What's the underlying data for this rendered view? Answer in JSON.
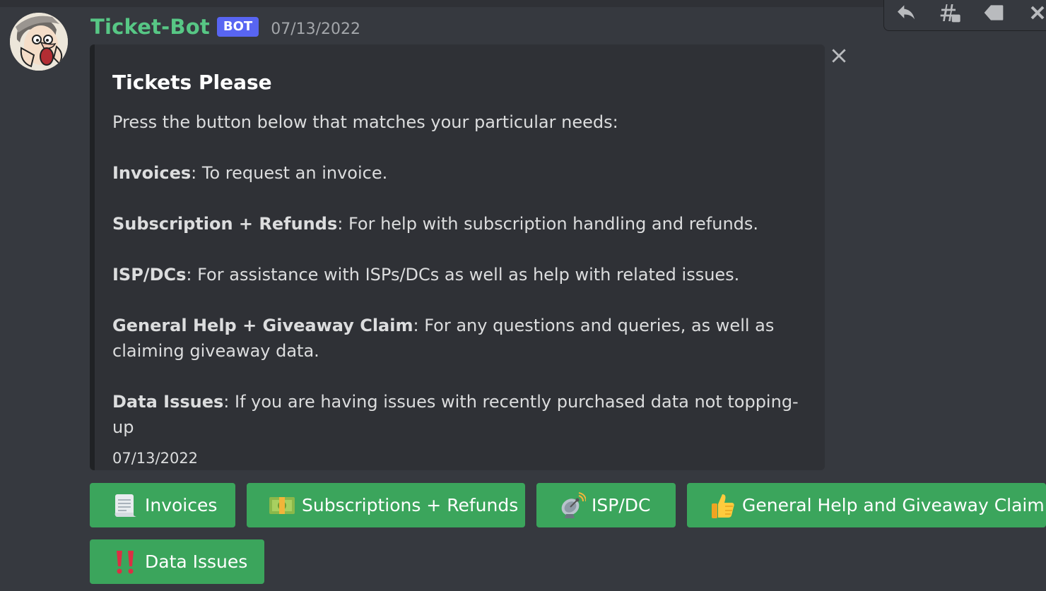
{
  "message": {
    "username": "Ticket-Bot",
    "badge": "BOT",
    "timestamp": "07/13/2022",
    "avatar_icon": "cartoon-man-avatar"
  },
  "toolbar": {
    "icons": [
      "reply-icon",
      "thread-icon",
      "tag-icon",
      "more-icon"
    ]
  },
  "embed": {
    "title": "Tickets Please",
    "intro": "Press the button below that matches your particular needs:",
    "items": [
      {
        "label": "Invoices",
        "text": ": To request an invoice."
      },
      {
        "label": "Subscription + Refunds",
        "text": ": For help with subscription handling and refunds."
      },
      {
        "label": "ISP/DCs",
        "text": ": For assistance with ISPs/DCs as well as help with related issues."
      },
      {
        "label": "General Help + Giveaway Claim",
        "text": ": For any questions and queries, as well as claiming giveaway data."
      },
      {
        "label": "Data Issues",
        "text": ": If you are having issues with recently purchased data not topping-up"
      }
    ],
    "footer": "07/13/2022",
    "border_color": "#202225"
  },
  "buttons": [
    {
      "label": "Invoices",
      "icon": "page-icon"
    },
    {
      "label": "Subscriptions + Refunds",
      "icon": "money-icon"
    },
    {
      "label": "ISP/DC",
      "icon": "satellite-dish-icon"
    },
    {
      "label": "General Help and Giveaway Claim",
      "icon": "thumbs-up-icon"
    },
    {
      "label": "Data Issues",
      "icon": "double-exclamation-icon"
    }
  ],
  "colors": {
    "background": "#36393f",
    "embed_bg": "#2f3136",
    "username": "#57c785",
    "badge": "#5865f2",
    "button_green": "#3ba55c"
  }
}
